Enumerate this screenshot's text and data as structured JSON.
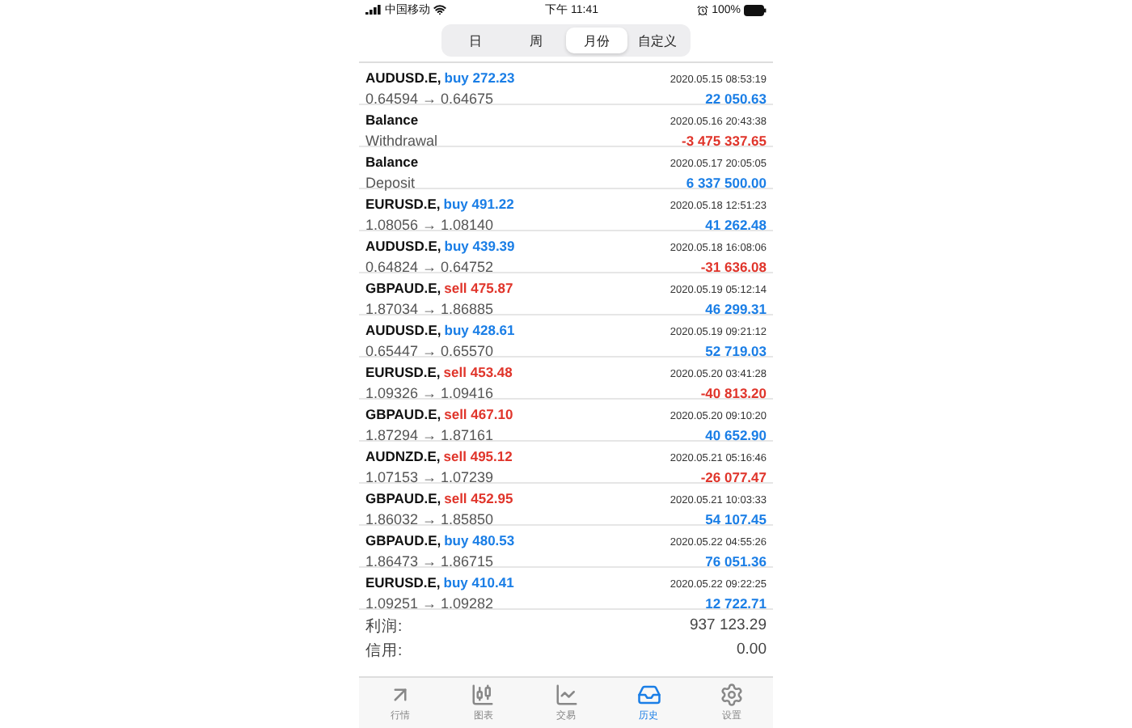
{
  "status_bar": {
    "carrier": "中国移动",
    "time": "下午 11:41",
    "battery": "100%"
  },
  "period_tabs": [
    {
      "label": "日",
      "selected": false
    },
    {
      "label": "周",
      "selected": false
    },
    {
      "label": "月份",
      "selected": true
    },
    {
      "label": "自定义",
      "selected": false
    }
  ],
  "history": [
    {
      "kind": "trade",
      "symbol": "AUDUSD.E,",
      "side": "buy",
      "volume": "272.23",
      "sell": false,
      "time": "2020.05.15 08:53:19",
      "prices": "0.64594 → 0.64675",
      "amount": "22 050.63",
      "loss": false
    },
    {
      "kind": "balance",
      "symbol": "Balance",
      "time": "2020.05.16 20:43:38",
      "prices": "Withdrawal",
      "amount": "-3 475 337.65",
      "loss": true
    },
    {
      "kind": "balance",
      "symbol": "Balance",
      "time": "2020.05.17 20:05:05",
      "prices": "Deposit",
      "amount": "6 337 500.00",
      "loss": false
    },
    {
      "kind": "trade",
      "symbol": "EURUSD.E,",
      "side": "buy",
      "volume": "491.22",
      "sell": false,
      "time": "2020.05.18 12:51:23",
      "prices": "1.08056 → 1.08140",
      "amount": "41 262.48",
      "loss": false
    },
    {
      "kind": "trade",
      "symbol": "AUDUSD.E,",
      "side": "buy",
      "volume": "439.39",
      "sell": false,
      "time": "2020.05.18 16:08:06",
      "prices": "0.64824 → 0.64752",
      "amount": "-31 636.08",
      "loss": true
    },
    {
      "kind": "trade",
      "symbol": "GBPAUD.E,",
      "side": "sell",
      "volume": "475.87",
      "sell": true,
      "time": "2020.05.19 05:12:14",
      "prices": "1.87034 → 1.86885",
      "amount": "46 299.31",
      "loss": false
    },
    {
      "kind": "trade",
      "symbol": "AUDUSD.E,",
      "side": "buy",
      "volume": "428.61",
      "sell": false,
      "time": "2020.05.19 09:21:12",
      "prices": "0.65447 → 0.65570",
      "amount": "52 719.03",
      "loss": false
    },
    {
      "kind": "trade",
      "symbol": "EURUSD.E,",
      "side": "sell",
      "volume": "453.48",
      "sell": true,
      "time": "2020.05.20 03:41:28",
      "prices": "1.09326 → 1.09416",
      "amount": "-40 813.20",
      "loss": true
    },
    {
      "kind": "trade",
      "symbol": "GBPAUD.E,",
      "side": "sell",
      "volume": "467.10",
      "sell": true,
      "time": "2020.05.20 09:10:20",
      "prices": "1.87294 → 1.87161",
      "amount": "40 652.90",
      "loss": false
    },
    {
      "kind": "trade",
      "symbol": "AUDNZD.E,",
      "side": "sell",
      "volume": "495.12",
      "sell": true,
      "time": "2020.05.21 05:16:46",
      "prices": "1.07153 → 1.07239",
      "amount": "-26 077.47",
      "loss": true
    },
    {
      "kind": "trade",
      "symbol": "GBPAUD.E,",
      "side": "sell",
      "volume": "452.95",
      "sell": true,
      "time": "2020.05.21 10:03:33",
      "prices": "1.86032 → 1.85850",
      "amount": "54 107.45",
      "loss": false
    },
    {
      "kind": "trade",
      "symbol": "GBPAUD.E,",
      "side": "buy",
      "volume": "480.53",
      "sell": false,
      "time": "2020.05.22 04:55:26",
      "prices": "1.86473 → 1.86715",
      "amount": "76 051.36",
      "loss": false
    },
    {
      "kind": "trade",
      "symbol": "EURUSD.E,",
      "side": "buy",
      "volume": "410.41",
      "sell": false,
      "time": "2020.05.22 09:22:25",
      "prices": "1.09251 → 1.09282",
      "amount": "12 722.71",
      "loss": false
    }
  ],
  "summary": [
    {
      "label": "利润:",
      "value": "937 123.29"
    },
    {
      "label": "信用:",
      "value": "0.00"
    }
  ],
  "tab_bar": [
    {
      "label": "行情",
      "selected": false
    },
    {
      "label": "图表",
      "selected": false
    },
    {
      "label": "交易",
      "selected": false
    },
    {
      "label": "历史",
      "selected": true
    },
    {
      "label": "设置",
      "selected": false
    }
  ]
}
